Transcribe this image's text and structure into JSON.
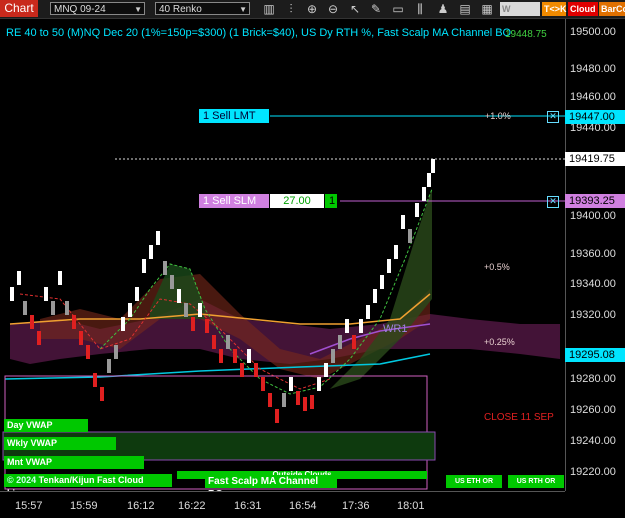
{
  "toolbar": {
    "chart_button": "Chart",
    "instrument": "MNQ 09-24",
    "bar_type": "40 Renko",
    "wvwap": "W VWAP",
    "tk": "T<>K",
    "cloud": "Cloud",
    "barco": "BarCo"
  },
  "title": "RE 40 to 50 (M)NQ Dec 20 (1%=150p=$300) (1 Brick=$40), US Dy RTH %, Fast Scalp MA Channel BO",
  "top_right_value": "19448.75",
  "price_axis": [
    "19500.00",
    "19480.00",
    "19460.00",
    "19440.00",
    "19400.00",
    "19360.00",
    "19340.00",
    "19320.00",
    "19280.00",
    "19260.00",
    "19240.00",
    "19220.00"
  ],
  "price_flags": {
    "sell_lmt_price": "19447.00",
    "last_price": "19419.75",
    "sell_slm_price": "19393.25",
    "lower_price": "19295.08"
  },
  "orders": {
    "sell_lmt": "1 Sell LMT",
    "sell_slm": "1 Sell SLM",
    "slm_value": "27.00",
    "slm_qty": "1"
  },
  "percent_labels": {
    "plus_1": "+1.0%",
    "plus_05": "+0.5%",
    "plus_025": "+0.25%",
    "close": "CLOSE 11 SEP"
  },
  "indicator_labels": {
    "wr1": "WR1",
    "day_vwap": "Day VWAP",
    "wkly_vwap": "Wkly VWAP",
    "mnt_vwap": "Mnt VWAP",
    "kijun": "Tenkan/Kijun Fast Cloud Lines",
    "copyright": "© 2024",
    "fast_scalp": "Fast Scalp MA Channel BO",
    "outside_clouds": "Outside Clouds",
    "us_eth_or": "US ETH OR",
    "us_rth_or": "US RTH OR"
  },
  "time_axis": [
    "15:57",
    "15:59",
    "16:12",
    "16:22",
    "16:31",
    "16:54",
    "17:36",
    "18:01"
  ],
  "colors": {
    "cyan": "#00e5ff",
    "green": "#00c800",
    "magenta": "#c060d0",
    "red_close": "#e02020"
  }
}
